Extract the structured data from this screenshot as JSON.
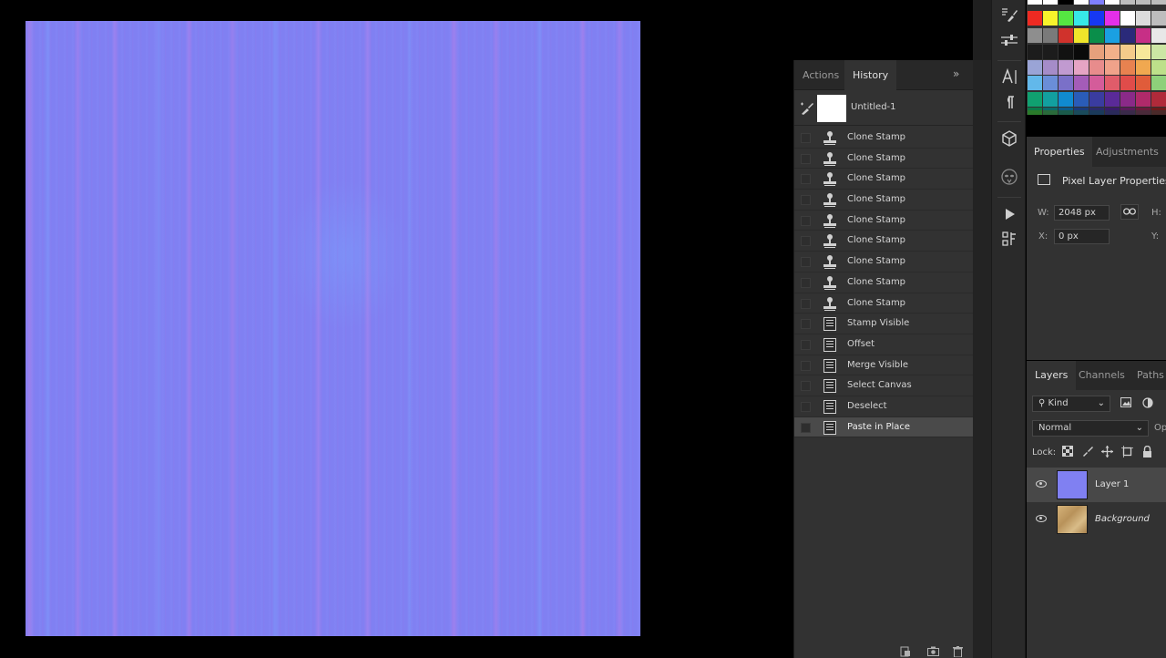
{
  "history": {
    "tabs": [
      "Actions",
      "History"
    ],
    "active_tab": "History",
    "collapse_glyph": "»",
    "snapshot_label": "Untitled-1",
    "items": [
      {
        "label": "Clone Stamp",
        "icon": "clone-stamp-icon"
      },
      {
        "label": "Clone Stamp",
        "icon": "clone-stamp-icon"
      },
      {
        "label": "Clone Stamp",
        "icon": "clone-stamp-icon"
      },
      {
        "label": "Clone Stamp",
        "icon": "clone-stamp-icon"
      },
      {
        "label": "Clone Stamp",
        "icon": "clone-stamp-icon"
      },
      {
        "label": "Clone Stamp",
        "icon": "clone-stamp-icon"
      },
      {
        "label": "Clone Stamp",
        "icon": "clone-stamp-icon"
      },
      {
        "label": "Clone Stamp",
        "icon": "clone-stamp-icon"
      },
      {
        "label": "Clone Stamp",
        "icon": "clone-stamp-icon"
      },
      {
        "label": "Stamp Visible",
        "icon": "history-state-icon"
      },
      {
        "label": "Offset",
        "icon": "history-state-icon"
      },
      {
        "label": "Merge Visible",
        "icon": "history-state-icon"
      },
      {
        "label": "Select Canvas",
        "icon": "history-state-icon"
      },
      {
        "label": "Deselect",
        "icon": "history-state-icon"
      },
      {
        "label": "Paste in Place",
        "icon": "history-state-icon",
        "selected": true
      }
    ]
  },
  "properties": {
    "tabs": [
      "Properties",
      "Adjustments"
    ],
    "active_tab": "Properties",
    "header": "Pixel Layer Properties",
    "w_label": "W:",
    "w_value": "2048 px",
    "h_label": "H:",
    "x_label": "X:",
    "x_value": "0 px",
    "y_label": "Y:"
  },
  "layers": {
    "tabs": [
      "Layers",
      "Channels",
      "Paths"
    ],
    "active_tab": "Layers",
    "filter_kind": "Kind",
    "blend_mode": "Normal",
    "opacity_label": "Op",
    "lock_label": "Lock:",
    "items": [
      {
        "name": "Layer 1",
        "selected": true,
        "visible": true
      },
      {
        "name": "Background",
        "italic": true,
        "visible": true
      }
    ]
  },
  "colors": {
    "canvas_texture": "#8080f2",
    "panel_bg": "#323232",
    "selected_row": "#4a4a4a",
    "background_thumb": "#c9a46b"
  }
}
